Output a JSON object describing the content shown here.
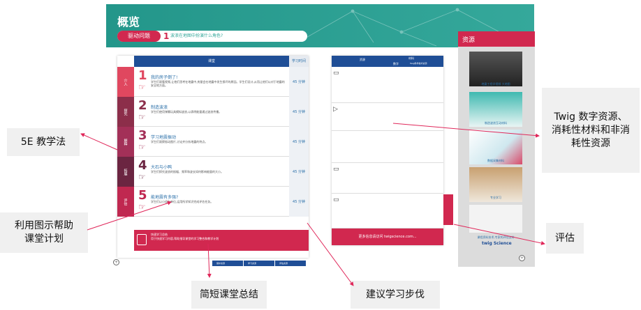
{
  "header": {
    "title": "概览"
  },
  "driving_question": {
    "button_label": "驱动问题",
    "number": "1",
    "text": "波浪在地图中扮演什么角色?"
  },
  "lesson_table": {
    "header_label": "课堂",
    "header_time": "学习时间",
    "rows": [
      {
        "phase": "介入",
        "phase_color": "#e0475f",
        "number": "1",
        "title": "我的房子倒了!",
        "desc": "学生们观看视频,让他们思考在地震中,房屋会在地震中发生损坏的原因。学生们设计,从而让他们以对于地震的安全地方面。",
        "time": "45 分钟"
      },
      {
        "phase": "探究",
        "phase_color": "#8c2e4a",
        "number": "2",
        "title": "制造波浪",
        "desc": "学生们使用弹簧玩具模拟波浪,以表明能量通过波浪传播。",
        "time": "45 分钟"
      },
      {
        "phase": "解释",
        "phase_color": "#a33058",
        "number": "3",
        "title": "学习地震振动",
        "desc": "学生们观察振动图片,讨论并分析地震的特点。",
        "time": "45 分钟"
      },
      {
        "phase": "拓展",
        "phase_color": "#6b2541",
        "number": "4",
        "title": "大石与小鸭",
        "desc": "学生们探究波浪的振幅、频率和波长如何影响能量的大小。",
        "time": "45 分钟"
      },
      {
        "phase": "评估",
        "phase_color": "#c02850",
        "number": "5",
        "title": "能地震有多强?",
        "desc": "学生们以小组为单位,运用所学知识完成评估任务。",
        "time": "45 分钟"
      }
    ],
    "summary_title": "快速学习总结",
    "summary_text": "用于快速学习内容,帮助指导课堂的学习整合和教学计划",
    "bottom_tabs": [
      "保护资源",
      "学习资源",
      "评估资源"
    ]
  },
  "right_table": {
    "header": [
      "资源",
      "材料",
      "数字",
      "Twig科学技术资源",
      "非消耗材料"
    ],
    "footer": "更多信息请访问 twigscience.com..."
  },
  "resources": {
    "title": "资源",
    "items": [
      {
        "caption": "地震工程学视频 大地图"
      },
      {
        "caption": "制造波浪互动材料"
      },
      {
        "caption": "数据采集材料"
      },
      {
        "caption": "专业学习"
      },
      {
        "caption": "课程资料技术,专家的评估支持"
      }
    ],
    "logo": "twig Science"
  },
  "callouts": {
    "twig": "Twig 数字资源、\n消耗性材料和非消\n耗性资源",
    "method": "5E 教学法",
    "diagram": "利用图示帮助\n课堂计划",
    "eval": "评估",
    "summary": "简短课堂总结",
    "steps": "建议学习步伐"
  },
  "colors": {
    "teal": "#2a9d8f",
    "navy": "#1f4e96",
    "crimson": "#d1284f"
  }
}
